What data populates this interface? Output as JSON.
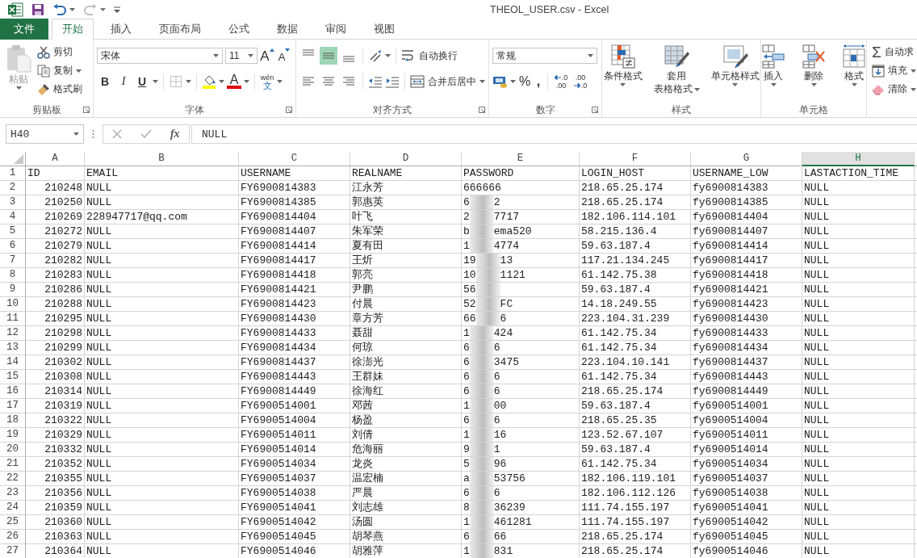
{
  "window": {
    "title": "THEOL_USER.csv - Excel"
  },
  "tabs": [
    {
      "label": "文件",
      "kind": "file",
      "selected": false
    },
    {
      "label": "开始",
      "kind": "tab",
      "selected": true
    },
    {
      "label": "插入",
      "kind": "tab",
      "selected": false
    },
    {
      "label": "页面布局",
      "kind": "tab",
      "selected": false
    },
    {
      "label": "公式",
      "kind": "tab",
      "selected": false
    },
    {
      "label": "数据",
      "kind": "tab",
      "selected": false
    },
    {
      "label": "审阅",
      "kind": "tab",
      "selected": false
    },
    {
      "label": "视图",
      "kind": "tab",
      "selected": false
    }
  ],
  "ribbon": {
    "groups": [
      {
        "kind": "clipboard",
        "label": "剪贴板",
        "paste": {
          "label": "粘贴",
          "disabled": true
        },
        "items": [
          {
            "label": "剪切"
          },
          {
            "label": "复制"
          },
          {
            "label": "格式刷"
          }
        ]
      },
      {
        "kind": "font",
        "label": "字体",
        "font_name": "宋体",
        "font_size": "11",
        "grow_font": "A",
        "shrink_font": "A",
        "bold": "B",
        "italic": "I",
        "underline": "U",
        "font_color": "A",
        "phonetic_top": "wén",
        "phonetic_bottom": "文"
      },
      {
        "kind": "alignment",
        "label": "对齐方式",
        "vertical": [
          {
            "selected": false
          },
          {
            "selected": true
          },
          {
            "selected": false
          }
        ],
        "horizontal": [
          {
            "selected": false
          },
          {
            "selected": false
          },
          {
            "selected": false
          }
        ],
        "wrap_text": "自动换行",
        "merge": "合并后居中"
      },
      {
        "kind": "number",
        "label": "数字",
        "format": "常规",
        "percent": "%",
        "comma": ",",
        "increase_decimal": {
          "top": ".0",
          "bottom": ".00"
        },
        "decrease_decimal": {
          "top": ".00",
          "bottom": ".0"
        }
      },
      {
        "kind": "styles",
        "label": "样式",
        "buttons": [
          {
            "label": "条件格式"
          },
          {
            "label": "套用",
            "label_line2": "表格格式"
          },
          {
            "label": "单元格样式"
          }
        ]
      },
      {
        "kind": "cells",
        "label": "单元格",
        "buttons": [
          {
            "label": "插入"
          },
          {
            "label": "删除"
          },
          {
            "label": "格式"
          }
        ]
      },
      {
        "kind": "editing",
        "sum_sign": "Σ",
        "items": [
          {
            "label": "自动求"
          },
          {
            "label": "填充"
          },
          {
            "label": "清除"
          }
        ]
      }
    ]
  },
  "formula_bar": {
    "name_box": "H40",
    "fx": "fx",
    "value": "NULL"
  },
  "sheet": {
    "columns": [
      {
        "letter": "A",
        "selected": false,
        "numeric": true
      },
      {
        "letter": "B",
        "selected": false,
        "numeric": false
      },
      {
        "letter": "C",
        "selected": false,
        "numeric": false
      },
      {
        "letter": "D",
        "selected": false,
        "numeric": false
      },
      {
        "letter": "E",
        "selected": false,
        "numeric": false
      },
      {
        "letter": "F",
        "selected": false,
        "numeric": false
      },
      {
        "letter": "G",
        "selected": false,
        "numeric": false
      },
      {
        "letter": "H",
        "selected": true,
        "numeric": false
      }
    ],
    "rows": [
      {
        "number": "1",
        "cells": [
          "ID",
          "EMAIL",
          "USERNAME",
          "REALNAME",
          "PASSWORD",
          "LOGIN_HOST",
          "USERNAME_LOW",
          "LASTACTION_TIME"
        ]
      },
      {
        "number": "2",
        "cells": [
          "210248",
          "NULL",
          "FY6900814383",
          "江永芳",
          "666666",
          "218.65.25.174",
          "fy6900814383",
          "NULL"
        ]
      },
      {
        "number": "3",
        "cells": [
          "210250",
          "NULL",
          "FY6900814385",
          "郭惠英",
          {
            "start": "6",
            "end": "2"
          },
          "218.65.25.174",
          "fy6900814385",
          "NULL"
        ]
      },
      {
        "number": "4",
        "cells": [
          "210269",
          "228947717@qq.com",
          "FY6900814404",
          "叶飞",
          {
            "start": "2",
            "end": "7717"
          },
          "182.106.114.101",
          "fy6900814404",
          "NULL"
        ]
      },
      {
        "number": "5",
        "cells": [
          "210272",
          "NULL",
          "FY6900814407",
          "朱军荣",
          {
            "start": "b",
            "end": "ema520"
          },
          "58.215.136.4",
          "fy6900814407",
          "NULL"
        ]
      },
      {
        "number": "6",
        "cells": [
          "210279",
          "NULL",
          "FY6900814414",
          "夏有田",
          {
            "start": "1",
            "end": "4774"
          },
          "59.63.187.4",
          "fy6900814414",
          "NULL"
        ]
      },
      {
        "number": "7",
        "cells": [
          "210282",
          "NULL",
          "FY6900814417",
          "王炘",
          {
            "start": "19",
            "end": "13"
          },
          "117.21.134.245",
          "fy6900814417",
          "NULL"
        ]
      },
      {
        "number": "8",
        "cells": [
          "210283",
          "NULL",
          "FY6900814418",
          "郭亮",
          {
            "start": "10",
            "end": "1121"
          },
          "61.142.75.38",
          "fy6900814418",
          "NULL"
        ]
      },
      {
        "number": "9",
        "cells": [
          "210286",
          "NULL",
          "FY6900814421",
          "尹鹏",
          {
            "start": "56"
          },
          "59.63.187.4",
          "fy6900814421",
          "NULL"
        ]
      },
      {
        "number": "10",
        "cells": [
          "210288",
          "NULL",
          "FY6900814423",
          "付晨",
          {
            "start": "52",
            "end": "FC"
          },
          "14.18.249.55",
          "fy6900814423",
          "NULL"
        ]
      },
      {
        "number": "11",
        "cells": [
          "210295",
          "NULL",
          "FY6900814430",
          "章方芳",
          {
            "start": "66",
            "end": "6"
          },
          "223.104.31.239",
          "fy6900814430",
          "NULL"
        ]
      },
      {
        "number": "12",
        "cells": [
          "210298",
          "NULL",
          "FY6900814433",
          "聂甜",
          {
            "start": "1",
            "end": "424"
          },
          "61.142.75.34",
          "fy6900814433",
          "NULL"
        ]
      },
      {
        "number": "13",
        "cells": [
          "210299",
          "NULL",
          "FY6900814434",
          "何琼",
          {
            "start": "6",
            "end": "6"
          },
          "61.142.75.34",
          "fy6900814434",
          "NULL"
        ]
      },
      {
        "number": "14",
        "cells": [
          "210302",
          "NULL",
          "FY6900814437",
          "徐澎光",
          {
            "start": "6",
            "end": "3475"
          },
          "223.104.10.141",
          "fy6900814437",
          "NULL"
        ]
      },
      {
        "number": "15",
        "cells": [
          "210308",
          "NULL",
          "FY6900814443",
          "王群妹",
          {
            "start": "6",
            "end": "6"
          },
          "61.142.75.34",
          "fy6900814443",
          "NULL"
        ]
      },
      {
        "number": "16",
        "cells": [
          "210314",
          "NULL",
          "FY6900814449",
          "徐海红",
          {
            "start": "6",
            "end": "6"
          },
          "218.65.25.174",
          "fy6900814449",
          "NULL"
        ]
      },
      {
        "number": "17",
        "cells": [
          "210319",
          "NULL",
          "FY6900514001",
          "邓茜",
          {
            "start": "1",
            "end": "00"
          },
          "59.63.187.4",
          "fy6900514001",
          "NULL"
        ]
      },
      {
        "number": "18",
        "cells": [
          "210322",
          "NULL",
          "FY6900514004",
          "杨盈",
          {
            "start": "6",
            "end": "6"
          },
          "218.65.25.35",
          "fy6900514004",
          "NULL"
        ]
      },
      {
        "number": "19",
        "cells": [
          "210329",
          "NULL",
          "FY6900514011",
          "刘倩",
          {
            "start": "1",
            "end": "16"
          },
          "123.52.67.107",
          "fy6900514011",
          "NULL"
        ]
      },
      {
        "number": "20",
        "cells": [
          "210332",
          "NULL",
          "FY6900514014",
          "危海丽",
          {
            "start": "9",
            "end": "1"
          },
          "59.63.187.4",
          "fy6900514014",
          "NULL"
        ]
      },
      {
        "number": "21",
        "cells": [
          "210352",
          "NULL",
          "FY6900514034",
          "龙炎",
          {
            "start": "5",
            "end": "96"
          },
          "61.142.75.34",
          "fy6900514034",
          "NULL"
        ]
      },
      {
        "number": "22",
        "cells": [
          "210355",
          "NULL",
          "FY6900514037",
          "温宏楠",
          {
            "start": "a",
            "end": "53756"
          },
          "182.106.119.101",
          "fy6900514037",
          "NULL"
        ]
      },
      {
        "number": "23",
        "cells": [
          "210356",
          "NULL",
          "FY6900514038",
          "严晨",
          {
            "start": "6",
            "end": "6"
          },
          "182.106.112.126",
          "fy6900514038",
          "NULL"
        ]
      },
      {
        "number": "24",
        "cells": [
          "210359",
          "NULL",
          "FY6900514041",
          "刘志雄",
          {
            "start": "8",
            "end": "36239"
          },
          "111.74.155.197",
          "fy6900514041",
          "NULL"
        ]
      },
      {
        "number": "25",
        "cells": [
          "210360",
          "NULL",
          "FY6900514042",
          "汤圆",
          {
            "start": "1",
            "end": "461281"
          },
          "111.74.155.197",
          "fy6900514042",
          "NULL"
        ]
      },
      {
        "number": "26",
        "cells": [
          "210363",
          "NULL",
          "FY6900514045",
          "胡琴燕",
          {
            "start": "6",
            "end": "66"
          },
          "218.65.25.174",
          "fy6900514045",
          "NULL"
        ]
      },
      {
        "number": "27",
        "cells": [
          "210364",
          "NULL",
          "FY6900514046",
          "胡雅萍",
          {
            "start": "1",
            "end": "831"
          },
          "218.65.25.174",
          "fy6900514046",
          "NULL"
        ]
      }
    ]
  }
}
